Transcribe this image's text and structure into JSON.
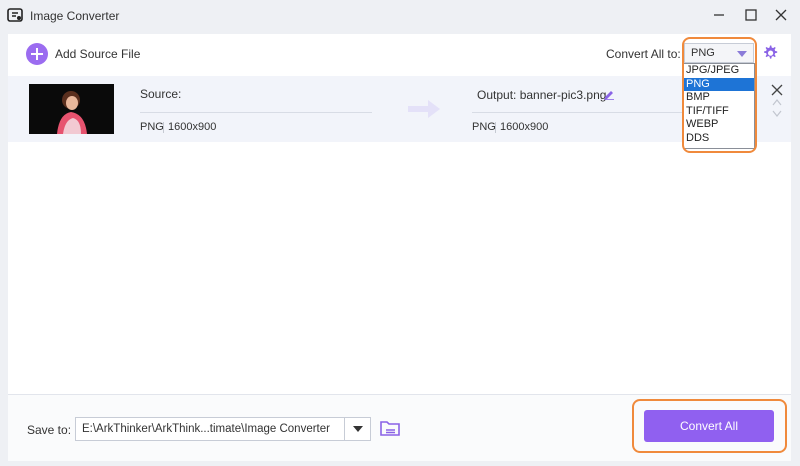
{
  "window": {
    "title": "Image Converter",
    "icon": "app-logo-icon"
  },
  "toolbar": {
    "add_label": "Add Source File",
    "convert_all_label": "Convert All to:",
    "format_value": "PNG"
  },
  "format_dropdown": {
    "options": [
      "JPG/JPEG",
      "PNG",
      "BMP",
      "TIF/TIFF",
      "WEBP",
      "DDS"
    ],
    "selected": "PNG"
  },
  "file": {
    "source_label": "Source:",
    "source_format": "PNG",
    "source_dims": "1600x900",
    "output_label": "Output: banner-pic3.png",
    "output_format": "PNG",
    "output_dims": "1600x900"
  },
  "footer": {
    "save_label": "Save to:",
    "save_path": "E:\\ArkThinker\\ArkThink...timate\\Image Converter",
    "convert_button": "Convert All"
  },
  "colors": {
    "accent": "#9060f0",
    "highlight": "#f08a3c",
    "selection": "#1e74d6"
  }
}
